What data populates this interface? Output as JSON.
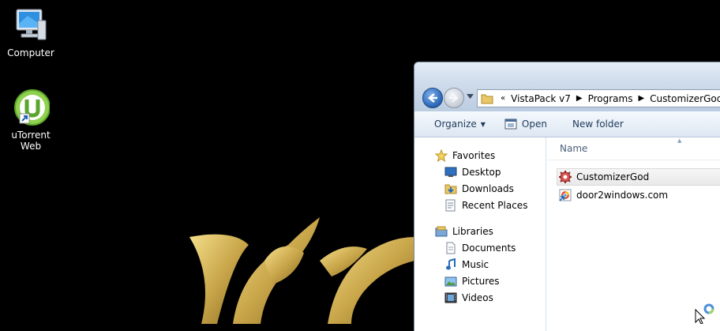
{
  "desktop": {
    "icons": [
      {
        "label": "Computer",
        "icon": "computer-icon"
      },
      {
        "label": "uTorrent Web",
        "icon": "utorrent-icon"
      }
    ]
  },
  "explorer": {
    "address": {
      "overflow": "«",
      "crumbs": [
        "VistaPack v7",
        "Programs",
        "CustomizerGod"
      ]
    },
    "toolbar": {
      "organize": "Organize",
      "open": "Open",
      "new_folder": "New folder"
    },
    "nav": {
      "favorites": {
        "label": "Favorites",
        "items": [
          "Desktop",
          "Downloads",
          "Recent Places"
        ]
      },
      "libraries": {
        "label": "Libraries",
        "items": [
          "Documents",
          "Music",
          "Pictures",
          "Videos"
        ]
      }
    },
    "column_header": "Name",
    "files": [
      {
        "name": "CustomizerGod",
        "icon": "gear-icon",
        "selected": true
      },
      {
        "name": "door2windows.com",
        "icon": "web-shortcut-icon",
        "selected": false
      }
    ]
  },
  "colors": {
    "accent": "#1e395b",
    "wallpaper_gold": "#c9a64a"
  }
}
